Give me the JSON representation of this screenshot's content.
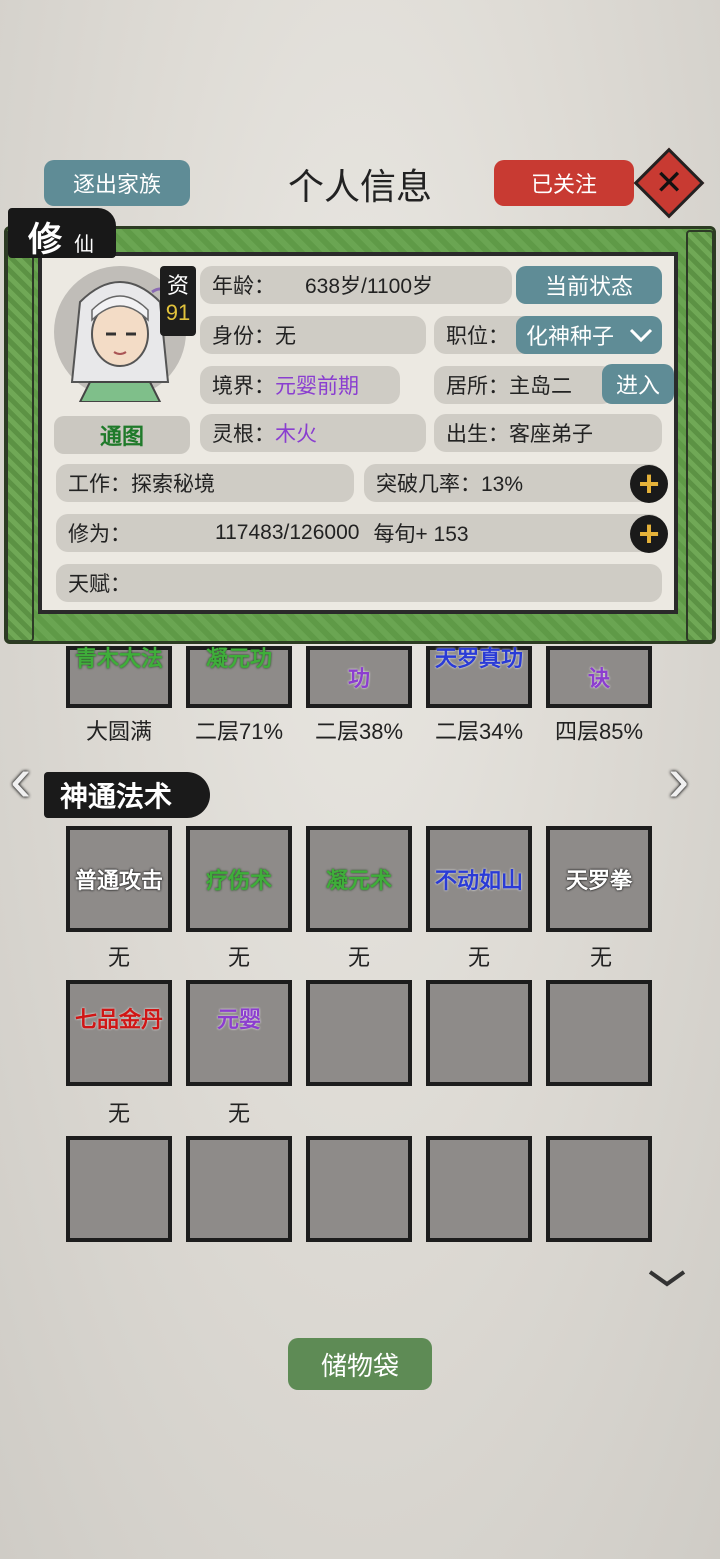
{
  "header": {
    "expel_label": "逐出家族",
    "title": "个人信息",
    "followed_label": "已关注",
    "close_symbol": "✕"
  },
  "tag": {
    "main": "修",
    "sub": "仙"
  },
  "profile": {
    "zi_label": "资",
    "zi_value": "91",
    "tutu_label": "通图",
    "age_label": "年龄：",
    "age_value": "638岁/1100岁",
    "status_button": "当前状态",
    "identity": "身份：无",
    "position_label": "职位：",
    "position_value": "化神种子",
    "realm_label": "境界：",
    "realm_value": "元婴前期",
    "residence": "居所：主岛二",
    "enter_button": "进入",
    "root_label": "灵根：",
    "root_value": "木火",
    "birth": "出生：客座弟子",
    "work": "工作：探索秘境",
    "breakthrough": "突破几率：13%",
    "cultivation_label": "修为：",
    "cultivation_value": "117483/126000",
    "per_turn": "每旬+ 153",
    "talent_label": "天赋："
  },
  "techniques": [
    {
      "name": "青木大法",
      "level": "大圆满",
      "color": "green"
    },
    {
      "name": "凝元功",
      "level": "二层71%",
      "color": "green"
    },
    {
      "name": "功",
      "level": "二层38%",
      "color": "purple"
    },
    {
      "name": "天罗真功",
      "level": "二层34%",
      "color": "blue"
    },
    {
      "name": "诀",
      "level": "四层85%",
      "color": "purple"
    }
  ],
  "section_title": "神通法术",
  "skills_row1": [
    {
      "name": "普通攻击",
      "sub": "无"
    },
    {
      "name": "疗伤术",
      "sub": "无"
    },
    {
      "name": "凝元术",
      "sub": "无"
    },
    {
      "name": "不动如山",
      "sub": "无"
    },
    {
      "name": "天罗拳",
      "sub": "无"
    }
  ],
  "skills_row2": [
    {
      "name": "七品金丹",
      "sub": "无"
    },
    {
      "name": "元婴",
      "sub": "无"
    }
  ],
  "storage_label": "储物袋",
  "icons": [
    "plus-icon",
    "chevron-down-icon",
    "arrow-left-icon",
    "arrow-right-icon",
    "close-icon",
    "avatar"
  ]
}
